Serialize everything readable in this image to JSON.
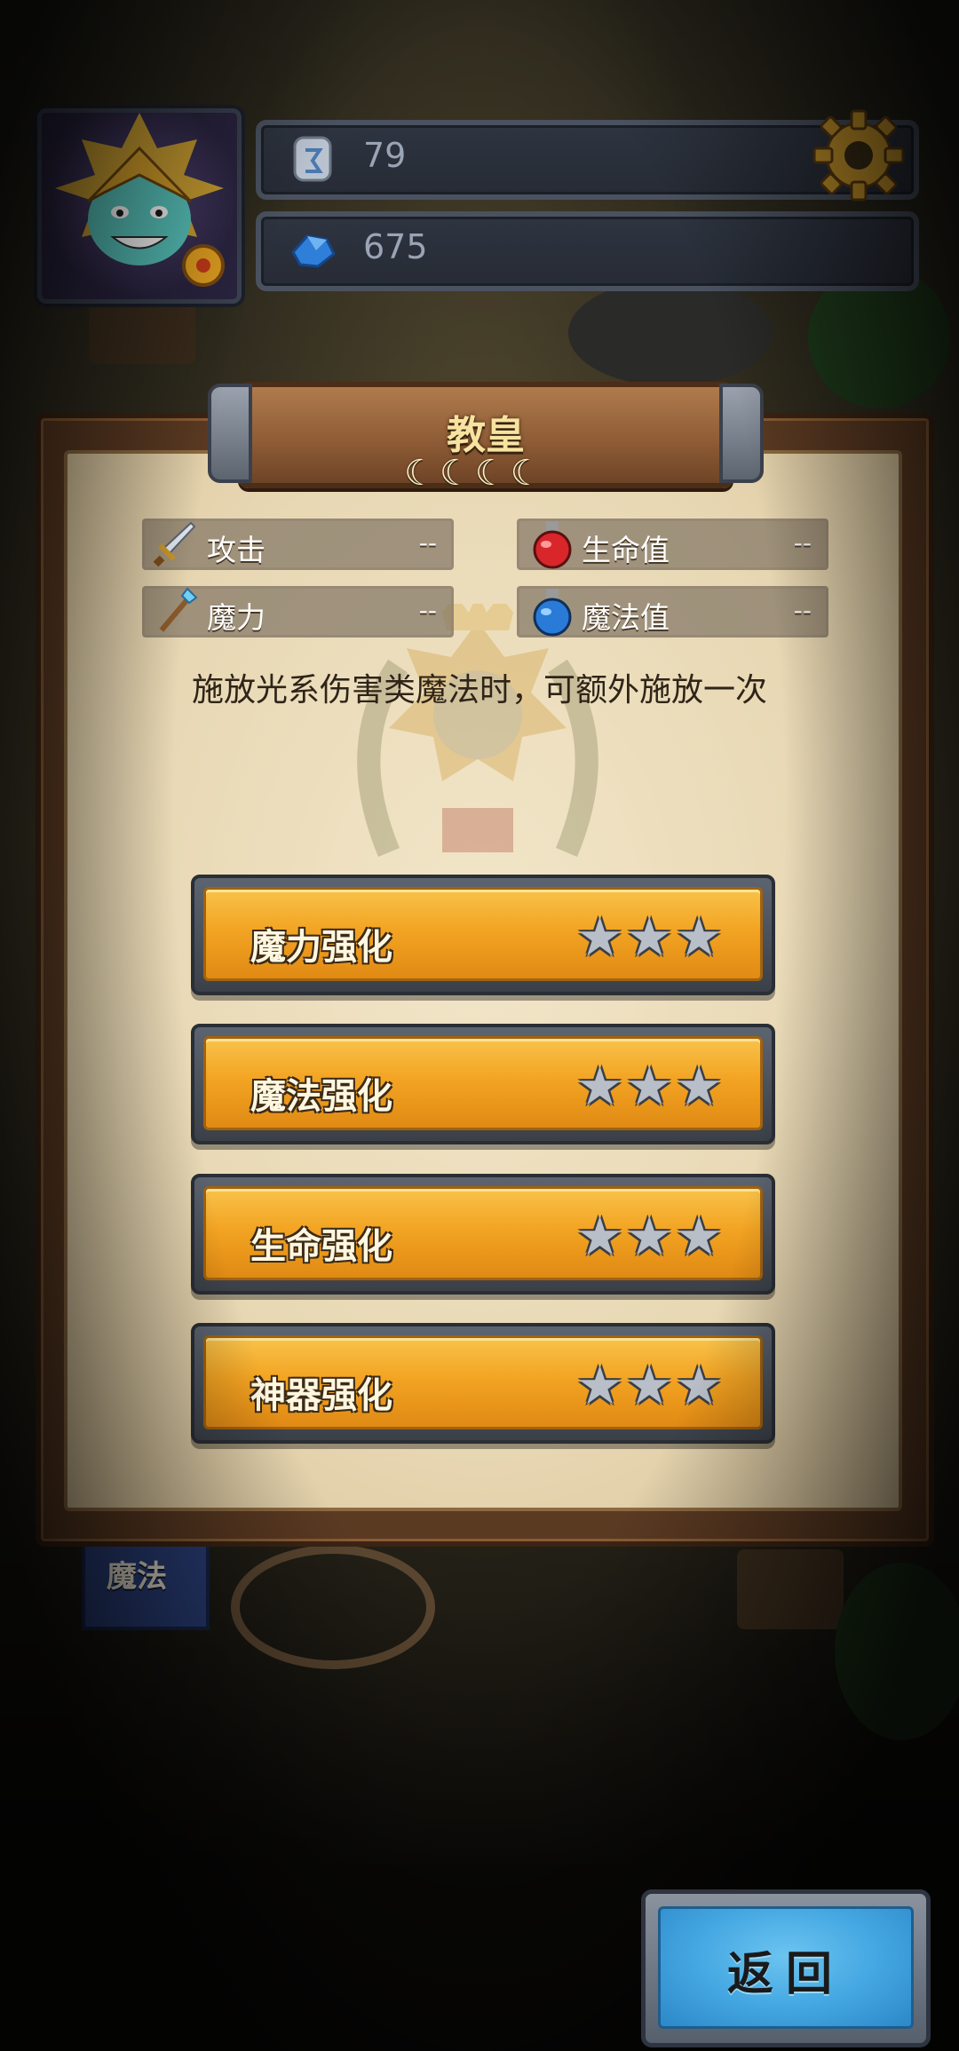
{
  "hud": {
    "resources": [
      {
        "icon": "rune-stone-icon",
        "value": "79"
      },
      {
        "icon": "blue-crystal-icon",
        "value": "675"
      }
    ],
    "settings_icon": "gear-icon"
  },
  "panel": {
    "title": "教皇",
    "moons": [
      "☾",
      "☾",
      "☾",
      "☾"
    ],
    "stats": [
      {
        "icon": "sword-icon",
        "label": "攻击",
        "value": "--"
      },
      {
        "icon": "red-potion-icon",
        "label": "生命值",
        "value": "--"
      },
      {
        "icon": "magic-staff-icon",
        "label": "魔力",
        "value": "--"
      },
      {
        "icon": "blue-potion-icon",
        "label": "魔法值",
        "value": "--"
      }
    ],
    "description": "施放光系伤害类魔法时，可额外施放一次",
    "upgrades": [
      {
        "label": "魔力强化",
        "stars_filled": 0,
        "stars_total": 3
      },
      {
        "label": "魔法强化",
        "stars_filled": 0,
        "stars_total": 3
      },
      {
        "label": "生命强化",
        "stars_filled": 0,
        "stars_total": 3
      },
      {
        "label": "神器强化",
        "stars_filled": 0,
        "stars_total": 3
      }
    ]
  },
  "background": {
    "banner_label": "魔法"
  },
  "buttons": {
    "back_label": "返回"
  },
  "colors": {
    "upgrade_button": "#f3a423",
    "back_button": "#45a8e2",
    "panel_paper": "#ecdcb8"
  }
}
